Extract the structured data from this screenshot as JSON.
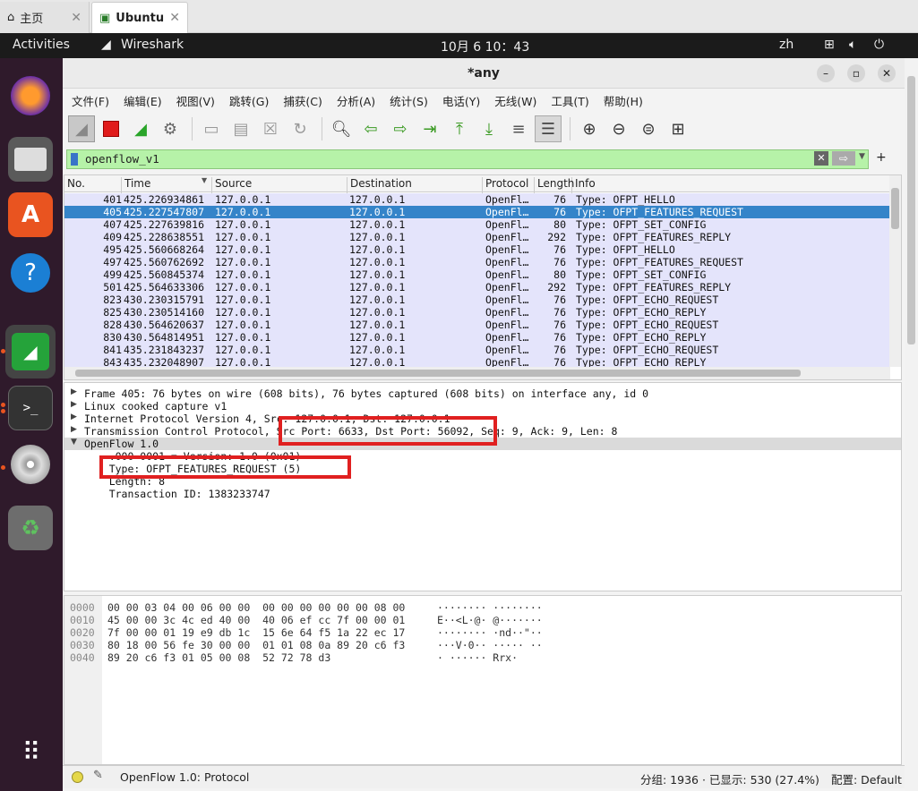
{
  "browser_tabs": [
    {
      "label": "主页",
      "close": "✕"
    },
    {
      "label": "Ubuntu",
      "close": "✕"
    }
  ],
  "topbar": {
    "activities": "Activities",
    "app": "Wireshark",
    "clock": "10月 6  10：43",
    "lang": "zh"
  },
  "window": {
    "title": "*any",
    "minimize": "–",
    "maximize": "▫",
    "close": "✕"
  },
  "menu": [
    "文件(F)",
    "编辑(E)",
    "视图(V)",
    "跳转(G)",
    "捕获(C)",
    "分析(A)",
    "统计(S)",
    "电话(Y)",
    "无线(W)",
    "工具(T)",
    "帮助(H)"
  ],
  "filter": {
    "value": "openflow_v1",
    "plus": "+"
  },
  "columns": [
    "No.",
    "Time",
    "Source",
    "Destination",
    "Protocol",
    "Length",
    "Info"
  ],
  "packets": [
    {
      "no": "401",
      "time": "425.226934861",
      "src": "127.0.0.1",
      "dst": "127.0.0.1",
      "proto": "OpenFl…",
      "len": "76",
      "info": "Type: OFPT_HELLO"
    },
    {
      "no": "405",
      "time": "425.227547807",
      "src": "127.0.0.1",
      "dst": "127.0.0.1",
      "proto": "OpenFl…",
      "len": "76",
      "info": "Type: OFPT_FEATURES_REQUEST"
    },
    {
      "no": "407",
      "time": "425.227639816",
      "src": "127.0.0.1",
      "dst": "127.0.0.1",
      "proto": "OpenFl…",
      "len": "80",
      "info": "Type: OFPT_SET_CONFIG"
    },
    {
      "no": "409",
      "time": "425.228638551",
      "src": "127.0.0.1",
      "dst": "127.0.0.1",
      "proto": "OpenFl…",
      "len": "292",
      "info": "Type: OFPT_FEATURES_REPLY"
    },
    {
      "no": "495",
      "time": "425.560668264",
      "src": "127.0.0.1",
      "dst": "127.0.0.1",
      "proto": "OpenFl…",
      "len": "76",
      "info": "Type: OFPT_HELLO"
    },
    {
      "no": "497",
      "time": "425.560762692",
      "src": "127.0.0.1",
      "dst": "127.0.0.1",
      "proto": "OpenFl…",
      "len": "76",
      "info": "Type: OFPT_FEATURES_REQUEST"
    },
    {
      "no": "499",
      "time": "425.560845374",
      "src": "127.0.0.1",
      "dst": "127.0.0.1",
      "proto": "OpenFl…",
      "len": "80",
      "info": "Type: OFPT_SET_CONFIG"
    },
    {
      "no": "501",
      "time": "425.564633306",
      "src": "127.0.0.1",
      "dst": "127.0.0.1",
      "proto": "OpenFl…",
      "len": "292",
      "info": "Type: OFPT_FEATURES_REPLY"
    },
    {
      "no": "823",
      "time": "430.230315791",
      "src": "127.0.0.1",
      "dst": "127.0.0.1",
      "proto": "OpenFl…",
      "len": "76",
      "info": "Type: OFPT_ECHO_REQUEST"
    },
    {
      "no": "825",
      "time": "430.230514160",
      "src": "127.0.0.1",
      "dst": "127.0.0.1",
      "proto": "OpenFl…",
      "len": "76",
      "info": "Type: OFPT_ECHO_REPLY"
    },
    {
      "no": "828",
      "time": "430.564620637",
      "src": "127.0.0.1",
      "dst": "127.0.0.1",
      "proto": "OpenFl…",
      "len": "76",
      "info": "Type: OFPT_ECHO_REQUEST"
    },
    {
      "no": "830",
      "time": "430.564814951",
      "src": "127.0.0.1",
      "dst": "127.0.0.1",
      "proto": "OpenFl…",
      "len": "76",
      "info": "Type: OFPT_ECHO_REPLY"
    },
    {
      "no": "841",
      "time": "435.231843237",
      "src": "127.0.0.1",
      "dst": "127.0.0.1",
      "proto": "OpenFl…",
      "len": "76",
      "info": "Type: OFPT_ECHO_REQUEST"
    },
    {
      "no": "843",
      "time": "435.232048907",
      "src": "127.0.0.1",
      "dst": "127.0.0.1",
      "proto": "OpenFl…",
      "len": "76",
      "info": "Type: OFPT_ECHO_REPLY"
    }
  ],
  "selected_packet": "405",
  "details": [
    "Frame 405: 76 bytes on wire (608 bits), 76 bytes captured (608 bits) on interface any, id 0",
    "Linux cooked capture v1",
    "Internet Protocol Version 4, Src: 127.0.0.1, Dst: 127.0.0.1",
    "Transmission Control Protocol, Src Port: 6633, Dst Port: 56092, Seq: 9, Ack: 9, Len: 8",
    "OpenFlow 1.0",
    "    .000 0001 = Version: 1.0 (0x01)",
    "    Type: OFPT_FEATURES_REQUEST (5)",
    "    Length: 8",
    "    Transaction ID: 1383233747"
  ],
  "bytes": [
    {
      "off": "0000",
      "hex": "00 00 03 04 00 06 00 00  00 00 00 00 00 00 08 00",
      "ascii": "········ ········"
    },
    {
      "off": "0010",
      "hex": "45 00 00 3c 4c ed 40 00  40 06 ef cc 7f 00 00 01",
      "ascii": "E··<L·@· @·······"
    },
    {
      "off": "0020",
      "hex": "7f 00 00 01 19 e9 db 1c  15 6e 64 f5 1a 22 ec 17",
      "ascii": "········ ·nd··\"··"
    },
    {
      "off": "0030",
      "hex": "80 18 00 56 fe 30 00 00  01 01 08 0a 89 20 c6 f3",
      "ascii": "···V·0·· ····· ··"
    },
    {
      "off": "0040",
      "hex": "89 20 c6 f3 01 05 00 08  52 72 78 d3",
      "ascii": "· ······ Rrx·"
    }
  ],
  "status": {
    "protocol": "OpenFlow 1.0: Protocol",
    "counts": "分组: 1936 · 已显示: 530 (27.4%)",
    "profile": "配置:  Default"
  }
}
